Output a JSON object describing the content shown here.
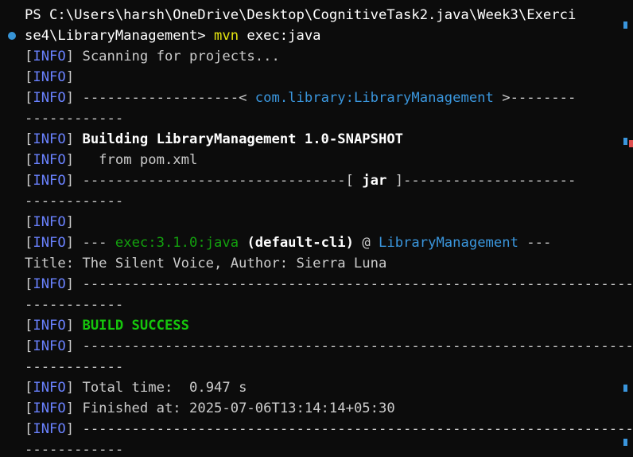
{
  "terminal": {
    "prompt": {
      "line1": "PS C:\\Users\\harsh\\OneDrive\\Desktop\\CognitiveTask2.java\\Week3\\Exerci",
      "line2_path": "se4\\LibraryManagement> ",
      "command": "mvn",
      "args": " exec:java"
    },
    "info_tag": "INFO",
    "scanning": " Scanning for projects...",
    "project_dash_left": " -------------------< ",
    "project_id": "com.library:LibraryManagement",
    "project_dash_right": " >--------",
    "wrap_dashes": "------------",
    "building": "Building LibraryManagement 1.0-SNAPSHOT",
    "from_pom": "   from pom.xml",
    "jar_dash_left": " --------------------------------[ ",
    "jar_label": "jar",
    "jar_dash_right": " ]---------------------",
    "exec_prefix": " --- ",
    "exec_goal": "exec:3.1.0:java",
    "exec_cli": " (default-cli)",
    "exec_at": " @ ",
    "exec_project": "LibraryManagement",
    "exec_suffix": " ---",
    "program_output": "Title: The Silent Voice, Author: Sierra Luna",
    "separator": " ------------------------------------------------------------------------",
    "build_success": "BUILD SUCCESS",
    "total_time": " Total time:  0.947 s",
    "finished_at": " Finished at: 2025-07-06T13:14:14+05:30"
  },
  "colors": {
    "background": "#0c0c0c",
    "info": "#6a82ff",
    "success": "#16c60c",
    "goal": "#13a10e",
    "project": "#3a96dd",
    "command": "#e5e510"
  }
}
